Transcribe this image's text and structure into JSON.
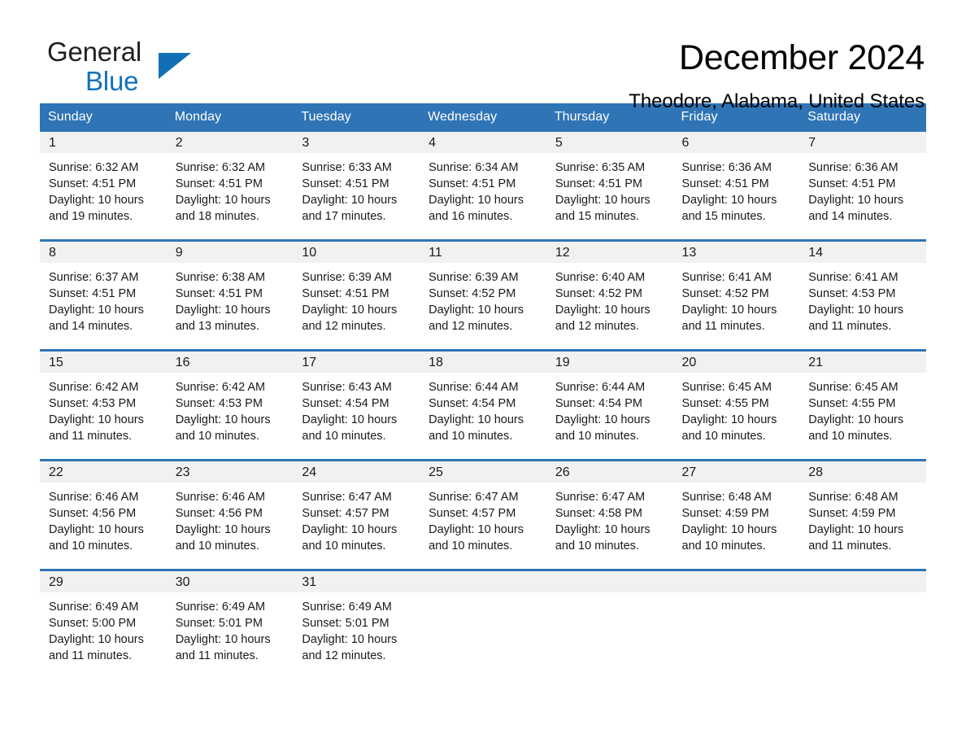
{
  "logo": {
    "line1": "General",
    "line2": "Blue",
    "triangle_color": "#136fb5",
    "text_color": "#231f20",
    "blue_text_color": "#1272bb"
  },
  "header": {
    "title": "December 2024",
    "subtitle": "Theodore, Alabama, United States"
  },
  "theme": {
    "header_bg": "#2f74b5",
    "header_text": "#ffffff",
    "row_divider": "#2f74b5",
    "daynum_bg": "#f1f1f1",
    "page_bg": "#ffffff",
    "body_text": "#1a1a1a"
  },
  "weekday_headers": [
    "Sunday",
    "Monday",
    "Tuesday",
    "Wednesday",
    "Thursday",
    "Friday",
    "Saturday"
  ],
  "weeks": [
    [
      {
        "day": "1",
        "sunrise": "Sunrise: 6:32 AM",
        "sunset": "Sunset: 4:51 PM",
        "daylight1": "Daylight: 10 hours",
        "daylight2": "and 19 minutes."
      },
      {
        "day": "2",
        "sunrise": "Sunrise: 6:32 AM",
        "sunset": "Sunset: 4:51 PM",
        "daylight1": "Daylight: 10 hours",
        "daylight2": "and 18 minutes."
      },
      {
        "day": "3",
        "sunrise": "Sunrise: 6:33 AM",
        "sunset": "Sunset: 4:51 PM",
        "daylight1": "Daylight: 10 hours",
        "daylight2": "and 17 minutes."
      },
      {
        "day": "4",
        "sunrise": "Sunrise: 6:34 AM",
        "sunset": "Sunset: 4:51 PM",
        "daylight1": "Daylight: 10 hours",
        "daylight2": "and 16 minutes."
      },
      {
        "day": "5",
        "sunrise": "Sunrise: 6:35 AM",
        "sunset": "Sunset: 4:51 PM",
        "daylight1": "Daylight: 10 hours",
        "daylight2": "and 15 minutes."
      },
      {
        "day": "6",
        "sunrise": "Sunrise: 6:36 AM",
        "sunset": "Sunset: 4:51 PM",
        "daylight1": "Daylight: 10 hours",
        "daylight2": "and 15 minutes."
      },
      {
        "day": "7",
        "sunrise": "Sunrise: 6:36 AM",
        "sunset": "Sunset: 4:51 PM",
        "daylight1": "Daylight: 10 hours",
        "daylight2": "and 14 minutes."
      }
    ],
    [
      {
        "day": "8",
        "sunrise": "Sunrise: 6:37 AM",
        "sunset": "Sunset: 4:51 PM",
        "daylight1": "Daylight: 10 hours",
        "daylight2": "and 14 minutes."
      },
      {
        "day": "9",
        "sunrise": "Sunrise: 6:38 AM",
        "sunset": "Sunset: 4:51 PM",
        "daylight1": "Daylight: 10 hours",
        "daylight2": "and 13 minutes."
      },
      {
        "day": "10",
        "sunrise": "Sunrise: 6:39 AM",
        "sunset": "Sunset: 4:51 PM",
        "daylight1": "Daylight: 10 hours",
        "daylight2": "and 12 minutes."
      },
      {
        "day": "11",
        "sunrise": "Sunrise: 6:39 AM",
        "sunset": "Sunset: 4:52 PM",
        "daylight1": "Daylight: 10 hours",
        "daylight2": "and 12 minutes."
      },
      {
        "day": "12",
        "sunrise": "Sunrise: 6:40 AM",
        "sunset": "Sunset: 4:52 PM",
        "daylight1": "Daylight: 10 hours",
        "daylight2": "and 12 minutes."
      },
      {
        "day": "13",
        "sunrise": "Sunrise: 6:41 AM",
        "sunset": "Sunset: 4:52 PM",
        "daylight1": "Daylight: 10 hours",
        "daylight2": "and 11 minutes."
      },
      {
        "day": "14",
        "sunrise": "Sunrise: 6:41 AM",
        "sunset": "Sunset: 4:53 PM",
        "daylight1": "Daylight: 10 hours",
        "daylight2": "and 11 minutes."
      }
    ],
    [
      {
        "day": "15",
        "sunrise": "Sunrise: 6:42 AM",
        "sunset": "Sunset: 4:53 PM",
        "daylight1": "Daylight: 10 hours",
        "daylight2": "and 11 minutes."
      },
      {
        "day": "16",
        "sunrise": "Sunrise: 6:42 AM",
        "sunset": "Sunset: 4:53 PM",
        "daylight1": "Daylight: 10 hours",
        "daylight2": "and 10 minutes."
      },
      {
        "day": "17",
        "sunrise": "Sunrise: 6:43 AM",
        "sunset": "Sunset: 4:54 PM",
        "daylight1": "Daylight: 10 hours",
        "daylight2": "and 10 minutes."
      },
      {
        "day": "18",
        "sunrise": "Sunrise: 6:44 AM",
        "sunset": "Sunset: 4:54 PM",
        "daylight1": "Daylight: 10 hours",
        "daylight2": "and 10 minutes."
      },
      {
        "day": "19",
        "sunrise": "Sunrise: 6:44 AM",
        "sunset": "Sunset: 4:54 PM",
        "daylight1": "Daylight: 10 hours",
        "daylight2": "and 10 minutes."
      },
      {
        "day": "20",
        "sunrise": "Sunrise: 6:45 AM",
        "sunset": "Sunset: 4:55 PM",
        "daylight1": "Daylight: 10 hours",
        "daylight2": "and 10 minutes."
      },
      {
        "day": "21",
        "sunrise": "Sunrise: 6:45 AM",
        "sunset": "Sunset: 4:55 PM",
        "daylight1": "Daylight: 10 hours",
        "daylight2": "and 10 minutes."
      }
    ],
    [
      {
        "day": "22",
        "sunrise": "Sunrise: 6:46 AM",
        "sunset": "Sunset: 4:56 PM",
        "daylight1": "Daylight: 10 hours",
        "daylight2": "and 10 minutes."
      },
      {
        "day": "23",
        "sunrise": "Sunrise: 6:46 AM",
        "sunset": "Sunset: 4:56 PM",
        "daylight1": "Daylight: 10 hours",
        "daylight2": "and 10 minutes."
      },
      {
        "day": "24",
        "sunrise": "Sunrise: 6:47 AM",
        "sunset": "Sunset: 4:57 PM",
        "daylight1": "Daylight: 10 hours",
        "daylight2": "and 10 minutes."
      },
      {
        "day": "25",
        "sunrise": "Sunrise: 6:47 AM",
        "sunset": "Sunset: 4:57 PM",
        "daylight1": "Daylight: 10 hours",
        "daylight2": "and 10 minutes."
      },
      {
        "day": "26",
        "sunrise": "Sunrise: 6:47 AM",
        "sunset": "Sunset: 4:58 PM",
        "daylight1": "Daylight: 10 hours",
        "daylight2": "and 10 minutes."
      },
      {
        "day": "27",
        "sunrise": "Sunrise: 6:48 AM",
        "sunset": "Sunset: 4:59 PM",
        "daylight1": "Daylight: 10 hours",
        "daylight2": "and 10 minutes."
      },
      {
        "day": "28",
        "sunrise": "Sunrise: 6:48 AM",
        "sunset": "Sunset: 4:59 PM",
        "daylight1": "Daylight: 10 hours",
        "daylight2": "and 11 minutes."
      }
    ],
    [
      {
        "day": "29",
        "sunrise": "Sunrise: 6:49 AM",
        "sunset": "Sunset: 5:00 PM",
        "daylight1": "Daylight: 10 hours",
        "daylight2": "and 11 minutes."
      },
      {
        "day": "30",
        "sunrise": "Sunrise: 6:49 AM",
        "sunset": "Sunset: 5:01 PM",
        "daylight1": "Daylight: 10 hours",
        "daylight2": "and 11 minutes."
      },
      {
        "day": "31",
        "sunrise": "Sunrise: 6:49 AM",
        "sunset": "Sunset: 5:01 PM",
        "daylight1": "Daylight: 10 hours",
        "daylight2": "and 12 minutes."
      },
      {
        "day": "",
        "sunrise": "",
        "sunset": "",
        "daylight1": "",
        "daylight2": ""
      },
      {
        "day": "",
        "sunrise": "",
        "sunset": "",
        "daylight1": "",
        "daylight2": ""
      },
      {
        "day": "",
        "sunrise": "",
        "sunset": "",
        "daylight1": "",
        "daylight2": ""
      },
      {
        "day": "",
        "sunrise": "",
        "sunset": "",
        "daylight1": "",
        "daylight2": ""
      }
    ]
  ]
}
